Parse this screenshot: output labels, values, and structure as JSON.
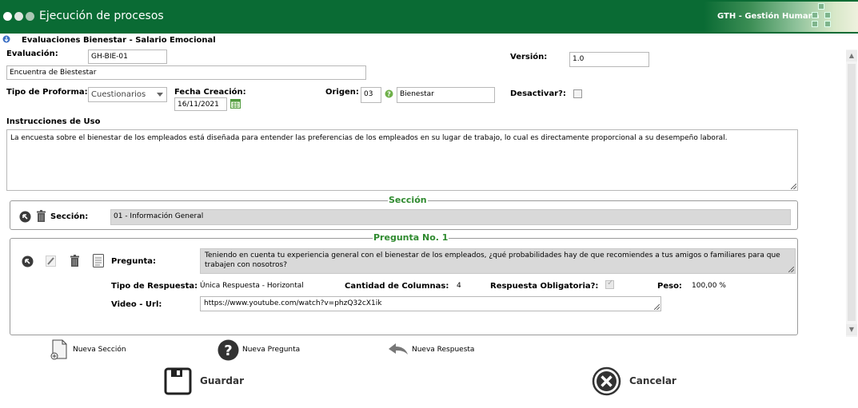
{
  "header": {
    "title": "Ejecución de procesos",
    "brand": "GTH - Gestión Humana"
  },
  "form": {
    "heading": "Evaluaciones Bienestar - Salario Emocional",
    "evaluacion_label": "Evaluación:",
    "evaluacion_code": "GH-BIE-01",
    "evaluacion_name": "Encuentra de Biestestar",
    "version_label": "Versión:",
    "version_value": "1.0",
    "tipo_proforma_label": "Tipo de Proforma:",
    "tipo_proforma_value": "Cuestionarios",
    "fecha_label": "Fecha Creación:",
    "fecha_value": "16/11/2021",
    "origen_label": "Origen:",
    "origen_code": "03",
    "origen_name": "Bienestar",
    "desactivar_label": "Desactivar?:",
    "desactivar_checked": false,
    "instrucciones_label": "Instrucciones de Uso",
    "instrucciones_value": "La encuesta sobre el bienestar de los empleados está diseñada para entender las preferencias de los empleados en su lugar de trabajo, lo cual es directamente proporcional a su desempeño laboral."
  },
  "seccion": {
    "legend": "Sección",
    "label": "Sección:",
    "value": "01 - Información General"
  },
  "pregunta": {
    "legend": "Pregunta No. 1",
    "label": "Pregunta:",
    "value": "Teniendo en cuenta tu experiencia general con el bienestar de los empleados, ¿qué probabilidades hay de que recomiendes a tus amigos o familiares para que trabajen con nosotros?",
    "tipo_respuesta_label": "Tipo de Respuesta:",
    "tipo_respuesta_value": "Única Respuesta - Horizontal",
    "cantidad_columnas_label": "Cantidad de Columnas:",
    "cantidad_columnas_value": "4",
    "obligatoria_label": "Respuesta Obligatoria?:",
    "obligatoria_checked": true,
    "peso_label": "Peso:",
    "peso_value": "100,00 %",
    "video_label": "Video - Url:",
    "video_value": "https://www.youtube.com/watch?v=phzQ32cX1ik"
  },
  "actions": {
    "nueva_seccion": "Nueva Sección",
    "nueva_pregunta": "Nueva Pregunta",
    "nueva_respuesta": "Nueva Respuesta",
    "guardar": "Guardar",
    "cancelar": "Cancelar"
  },
  "colors": {
    "header_green": "#0a6b34",
    "legend_green": "#2f8a2f"
  }
}
